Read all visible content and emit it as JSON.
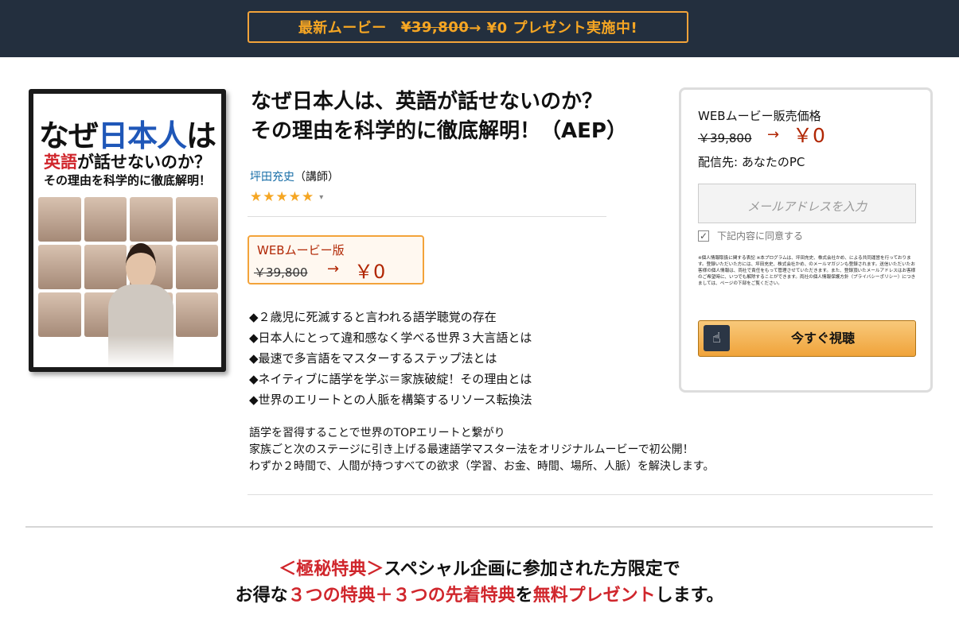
{
  "banner": {
    "prefix": "最新ムービー",
    "old_price": "¥39,800",
    "suffix": "→ ¥0 プレゼント実施中!"
  },
  "cover": {
    "line1_a": "なぜ",
    "line1_b": "日本人",
    "line1_c": "は",
    "line2_a": "英語",
    "line2_b": "が話せないのか？",
    "line3": "その理由を科学的に徹底解明！"
  },
  "product": {
    "title_line1": "なぜ日本人は、英語が話せないのか？",
    "title_line2": "その理由を科学的に徹底解明！（AEP）",
    "author": "坪田充史",
    "author_role": "（講師）",
    "stars": "★★★★★",
    "rating_caret": "▾",
    "price_label": "WEBムービー版",
    "price_old": "￥39,800",
    "price_arrow": "→",
    "price_new": "￥0"
  },
  "features": [
    "◆２歳児に死滅すると言われる語学聴覚の存在",
    "◆日本人にとって違和感なく学べる世界３大言語とは",
    "◆最速で多言語をマスターするステップ法とは",
    "◆ネイティブに語学を学ぶ＝家族破綻！その理由とは",
    "◆世界のエリートとの人脈を構築するリソース転換法"
  ],
  "description": [
    "語学を習得することで世界のTOPエリートと繋がり",
    "家族ごと次のステージに引き上げる最速語学マスター法をオリジナルムービーで初公開！",
    "わずか２時間で、人間が持つすべての欲求（学習、お金、時間、場所、人脈）を解決します。"
  ],
  "buybox": {
    "label": "WEBムービー販売価格",
    "price_old": "￥39,800",
    "price_arrow": "→",
    "price_new": "￥0",
    "destination": "配信先: あなたのPC",
    "email_placeholder": "メールアドレスを入力",
    "agree_label": "下記内容に同意する",
    "fine_print": "※個人情報取扱に関する表記 ※本プログラムは、坪田充史、株式会社かめ、による共同運営を行っております。登録いただいた方には、坪田充史、株式会社かめ、のメールマガジンも登録されます。送信いただいたお客様の個人情報は、両社で責任をもって管理させていただきます。また、登録頂いたメールアドレスはお客様のご希望時に、いつでも解除することができます。両社の個人情報保護方針（プライバシーポリシー）につきましては、ページの下部をご覧ください。",
    "cta_label": "今すぐ視聴"
  },
  "bottom": {
    "line1_red": "＜極秘特典＞",
    "line1_rest": "スペシャル企画に参加された方限定で",
    "line2_a": "お得な",
    "line2_b": "３つの特典＋３つの先着特典",
    "line2_c": "を",
    "line2_d": "無料プレゼント",
    "line2_e": "します。"
  },
  "colors": {
    "header_bg": "#232f3e",
    "accent_orange": "#f6a623",
    "price_red": "#b12704",
    "promo_red": "#d0262c"
  }
}
